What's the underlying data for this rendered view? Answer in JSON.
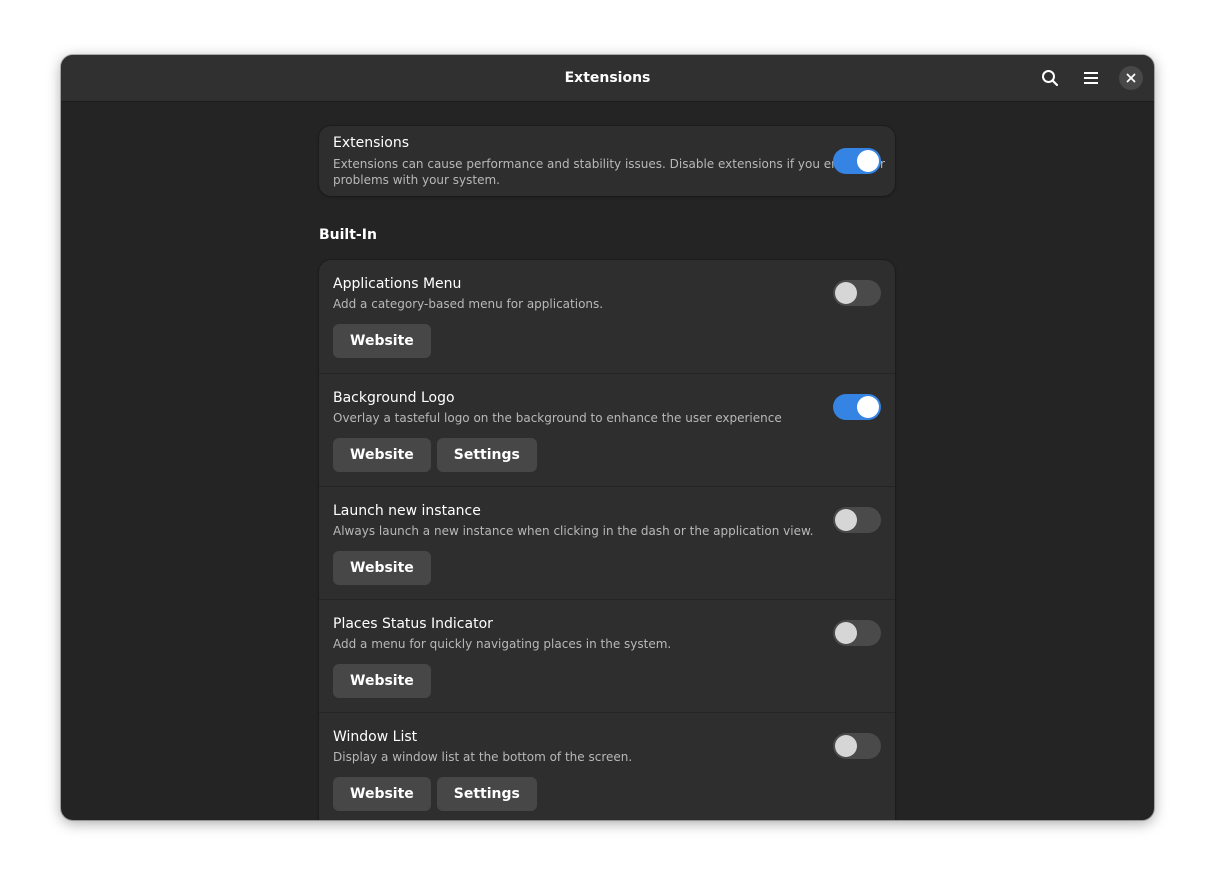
{
  "window": {
    "title": "Extensions"
  },
  "header": {
    "buttons": [
      {
        "icon": "search-icon"
      },
      {
        "icon": "hamburger-menu-icon"
      },
      {
        "icon": "close-icon"
      }
    ]
  },
  "master": {
    "title": "Extensions",
    "subtitle_line1": "Extensions can cause performance and stability issues. Disable extensions if you encounter",
    "subtitle_line2": "problems with your system.",
    "enabled": true
  },
  "section": {
    "heading": "Built-In"
  },
  "extensions": [
    {
      "name": "Applications Menu",
      "description": "Add a category-based menu for applications.",
      "enabled": false,
      "website_label": "Website"
    },
    {
      "name": "Background Logo",
      "description": "Overlay a tasteful logo on the background to enhance the user experience",
      "enabled": true,
      "website_label": "Website",
      "settings_label": "Settings"
    },
    {
      "name": "Launch new instance",
      "description": "Always launch a new instance when clicking in the dash or the application view.",
      "enabled": false,
      "website_label": "Website"
    },
    {
      "name": "Places Status Indicator",
      "description": "Add a menu for quickly navigating places in the system.",
      "enabled": false,
      "website_label": "Website"
    },
    {
      "name": "Window List",
      "description": "Display a window list at the bottom of the screen.",
      "enabled": false,
      "website_label": "Website",
      "settings_label": "Settings"
    }
  ],
  "colors": {
    "accent": "#3584e4",
    "window_bg": "#242424",
    "card_bg": "#2e2e2e",
    "button_bg": "#474747"
  }
}
